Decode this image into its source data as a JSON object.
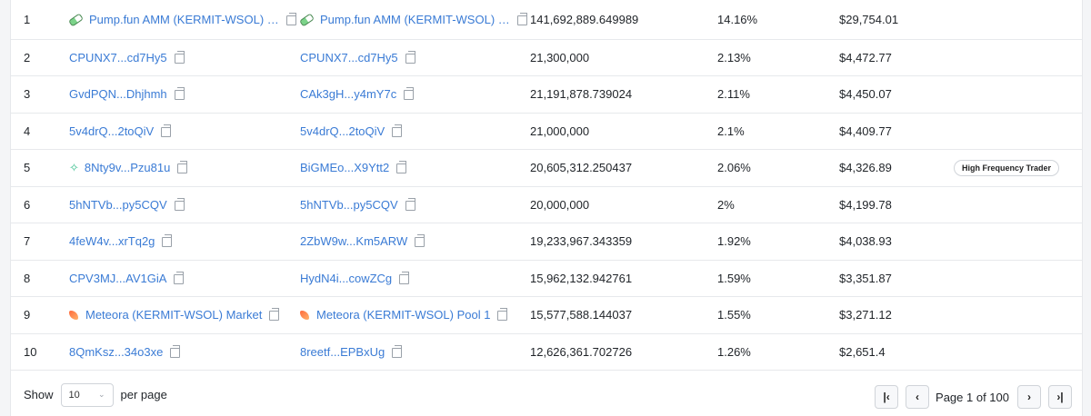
{
  "rows": [
    {
      "rank": "1",
      "owner": "Pump.fun AMM (KERMIT-WSOL) …",
      "owner_icon": "pill-icon",
      "account": "Pump.fun AMM (KERMIT-WSOL) …",
      "account_icon": "pill-icon",
      "quantity": "141,692,889.649989",
      "percentage": "14.16%",
      "value": "$29,754.01",
      "tag": ""
    },
    {
      "rank": "2",
      "owner": "CPUNX7...cd7Hy5",
      "owner_icon": "",
      "account": "CPUNX7...cd7Hy5",
      "account_icon": "",
      "quantity": "21,300,000",
      "percentage": "2.13%",
      "value": "$4,472.77",
      "tag": ""
    },
    {
      "rank": "3",
      "owner": "GvdPQN...Dhjhmh",
      "owner_icon": "",
      "account": "CAk3gH...y4mY7c",
      "account_icon": "",
      "quantity": "21,191,878.739024",
      "percentage": "2.11%",
      "value": "$4,450.07",
      "tag": ""
    },
    {
      "rank": "4",
      "owner": "5v4drQ...2toQiV",
      "owner_icon": "",
      "account": "5v4drQ...2toQiV",
      "account_icon": "",
      "quantity": "21,000,000",
      "percentage": "2.1%",
      "value": "$4,409.77",
      "tag": ""
    },
    {
      "rank": "5",
      "owner": "8Nty9v...Pzu81u",
      "owner_icon": "sparkle-icon",
      "account": "BiGMEo...X9Ytt2",
      "account_icon": "",
      "quantity": "20,605,312.250437",
      "percentage": "2.06%",
      "value": "$4,326.89",
      "tag": "High Frequency Trader"
    },
    {
      "rank": "6",
      "owner": "5hNTVb...py5CQV",
      "owner_icon": "",
      "account": "5hNTVb...py5CQV",
      "account_icon": "",
      "quantity": "20,000,000",
      "percentage": "2%",
      "value": "$4,199.78",
      "tag": ""
    },
    {
      "rank": "7",
      "owner": "4feW4v...xrTq2g",
      "owner_icon": "",
      "account": "2ZbW9w...Km5ARW",
      "account_icon": "",
      "quantity": "19,233,967.343359",
      "percentage": "1.92%",
      "value": "$4,038.93",
      "tag": ""
    },
    {
      "rank": "8",
      "owner": "CPV3MJ...AV1GiA",
      "owner_icon": "",
      "account": "HydN4i...cowZCg",
      "account_icon": "",
      "quantity": "15,962,132.942761",
      "percentage": "1.59%",
      "value": "$3,351.87",
      "tag": ""
    },
    {
      "rank": "9",
      "owner": "Meteora (KERMIT-WSOL) Market",
      "owner_icon": "meteora-icon",
      "account": "Meteora (KERMIT-WSOL) Pool 1",
      "account_icon": "meteora-icon",
      "quantity": "15,577,588.144037",
      "percentage": "1.55%",
      "value": "$3,271.12",
      "tag": ""
    },
    {
      "rank": "10",
      "owner": "8QmKsz...34o3xe",
      "owner_icon": "",
      "account": "8reetf...EPBxUg",
      "account_icon": "",
      "quantity": "12,626,361.702726",
      "percentage": "1.26%",
      "value": "$2,651.4",
      "tag": ""
    }
  ],
  "footer": {
    "show_label": "Show",
    "page_size": "10",
    "per_page_label": "per page",
    "page_text": "Page 1 of 100",
    "first_icon": "first-page-icon",
    "prev_icon": "chevron-left-icon",
    "next_icon": "chevron-right-icon",
    "last_icon": "last-page-icon"
  },
  "colors": {
    "link": "#3a7bd5",
    "border": "#e7e9ec",
    "background": "#f4f5f7"
  }
}
